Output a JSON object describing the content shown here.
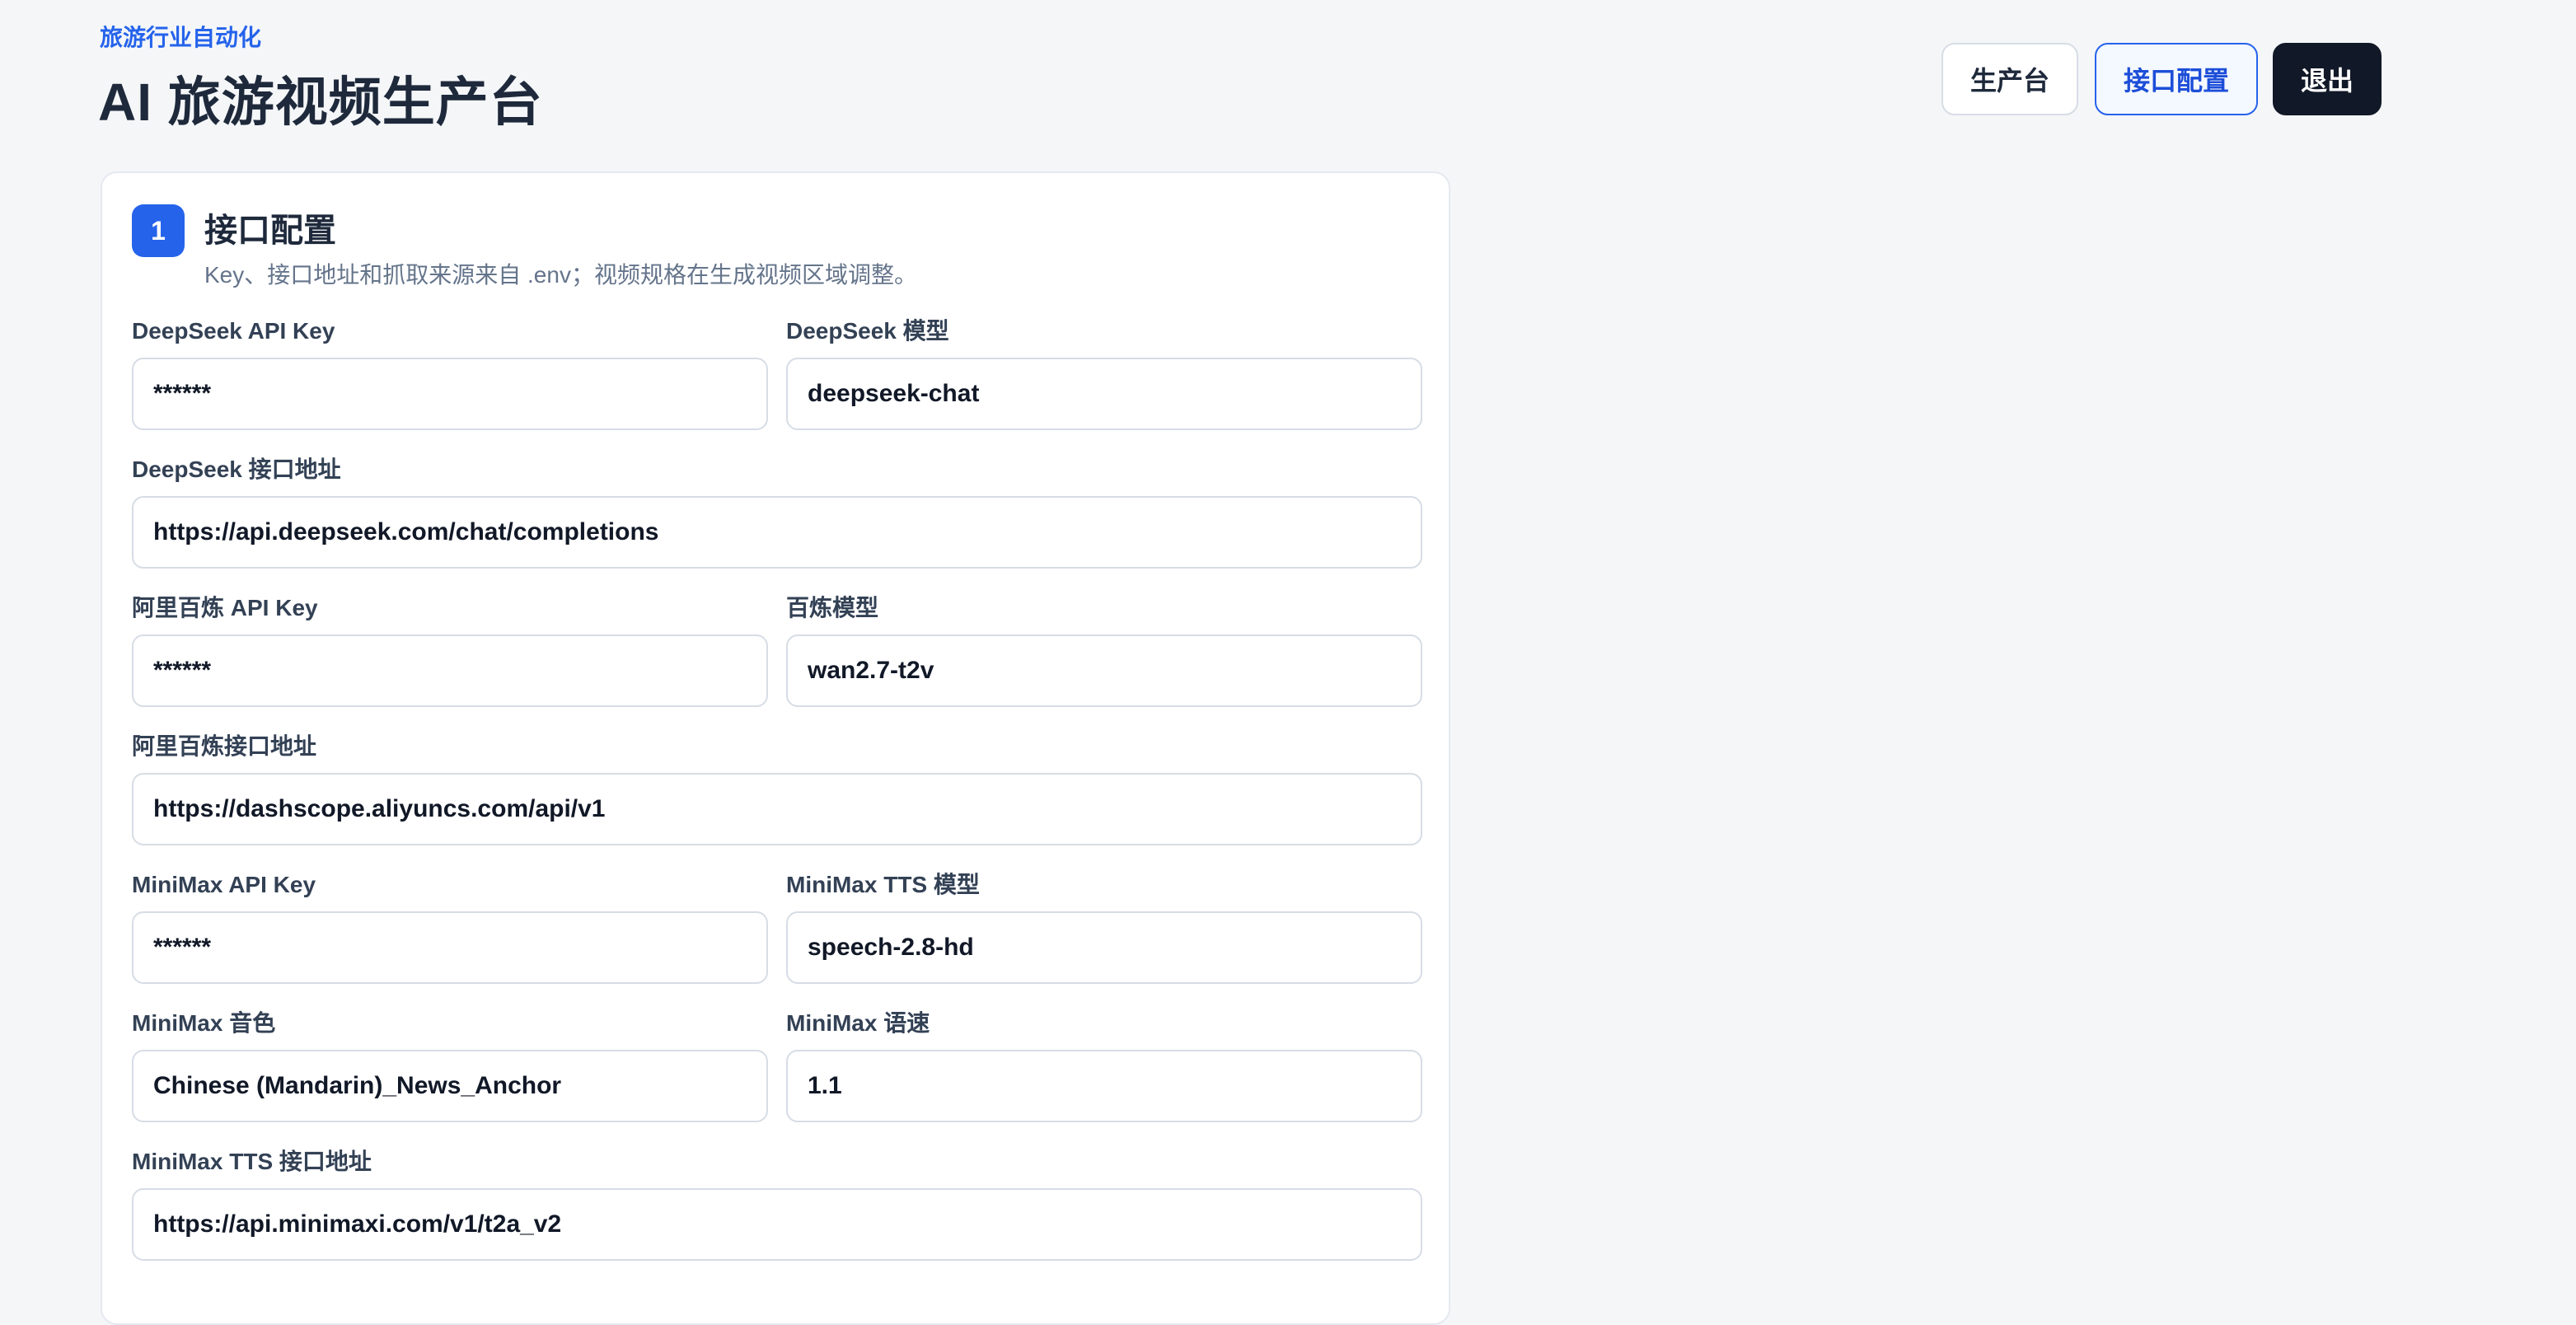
{
  "header": {
    "eyebrow": "旅游行业自动化",
    "title": "AI 旅游视频生产台"
  },
  "nav": {
    "production": "生产台",
    "api_config": "接口配置",
    "logout": "退出",
    "active": "api_config"
  },
  "section": {
    "step": "1",
    "title": "接口配置",
    "description": "Key、接口地址和抓取来源来自 .env；视频规格在生成视频区域调整。"
  },
  "fields": {
    "deepseek_api_key": {
      "label": "DeepSeek API Key",
      "value": "******"
    },
    "deepseek_model": {
      "label": "DeepSeek 模型",
      "value": "deepseek-chat"
    },
    "deepseek_endpoint": {
      "label": "DeepSeek 接口地址",
      "value": "https://api.deepseek.com/chat/completions"
    },
    "bailian_api_key": {
      "label": "阿里百炼 API Key",
      "value": "******"
    },
    "bailian_model": {
      "label": "百炼模型",
      "value": "wan2.7-t2v"
    },
    "bailian_endpoint": {
      "label": "阿里百炼接口地址",
      "value": "https://dashscope.aliyuncs.com/api/v1"
    },
    "minimax_api_key": {
      "label": "MiniMax API Key",
      "value": "******"
    },
    "minimax_tts_model": {
      "label": "MiniMax TTS 模型",
      "value": "speech-2.8-hd"
    },
    "minimax_voice": {
      "label": "MiniMax 音色",
      "value": "Chinese (Mandarin)_News_Anchor"
    },
    "minimax_speed": {
      "label": "MiniMax 语速",
      "value": "1.1"
    },
    "minimax_tts_endpoint": {
      "label": "MiniMax TTS 接口地址",
      "value": "https://api.minimaxi.com/v1/t2a_v2"
    }
  },
  "colors": {
    "accent": "#2563eb",
    "dark_button": "#111827",
    "background": "#f4f6f8"
  }
}
